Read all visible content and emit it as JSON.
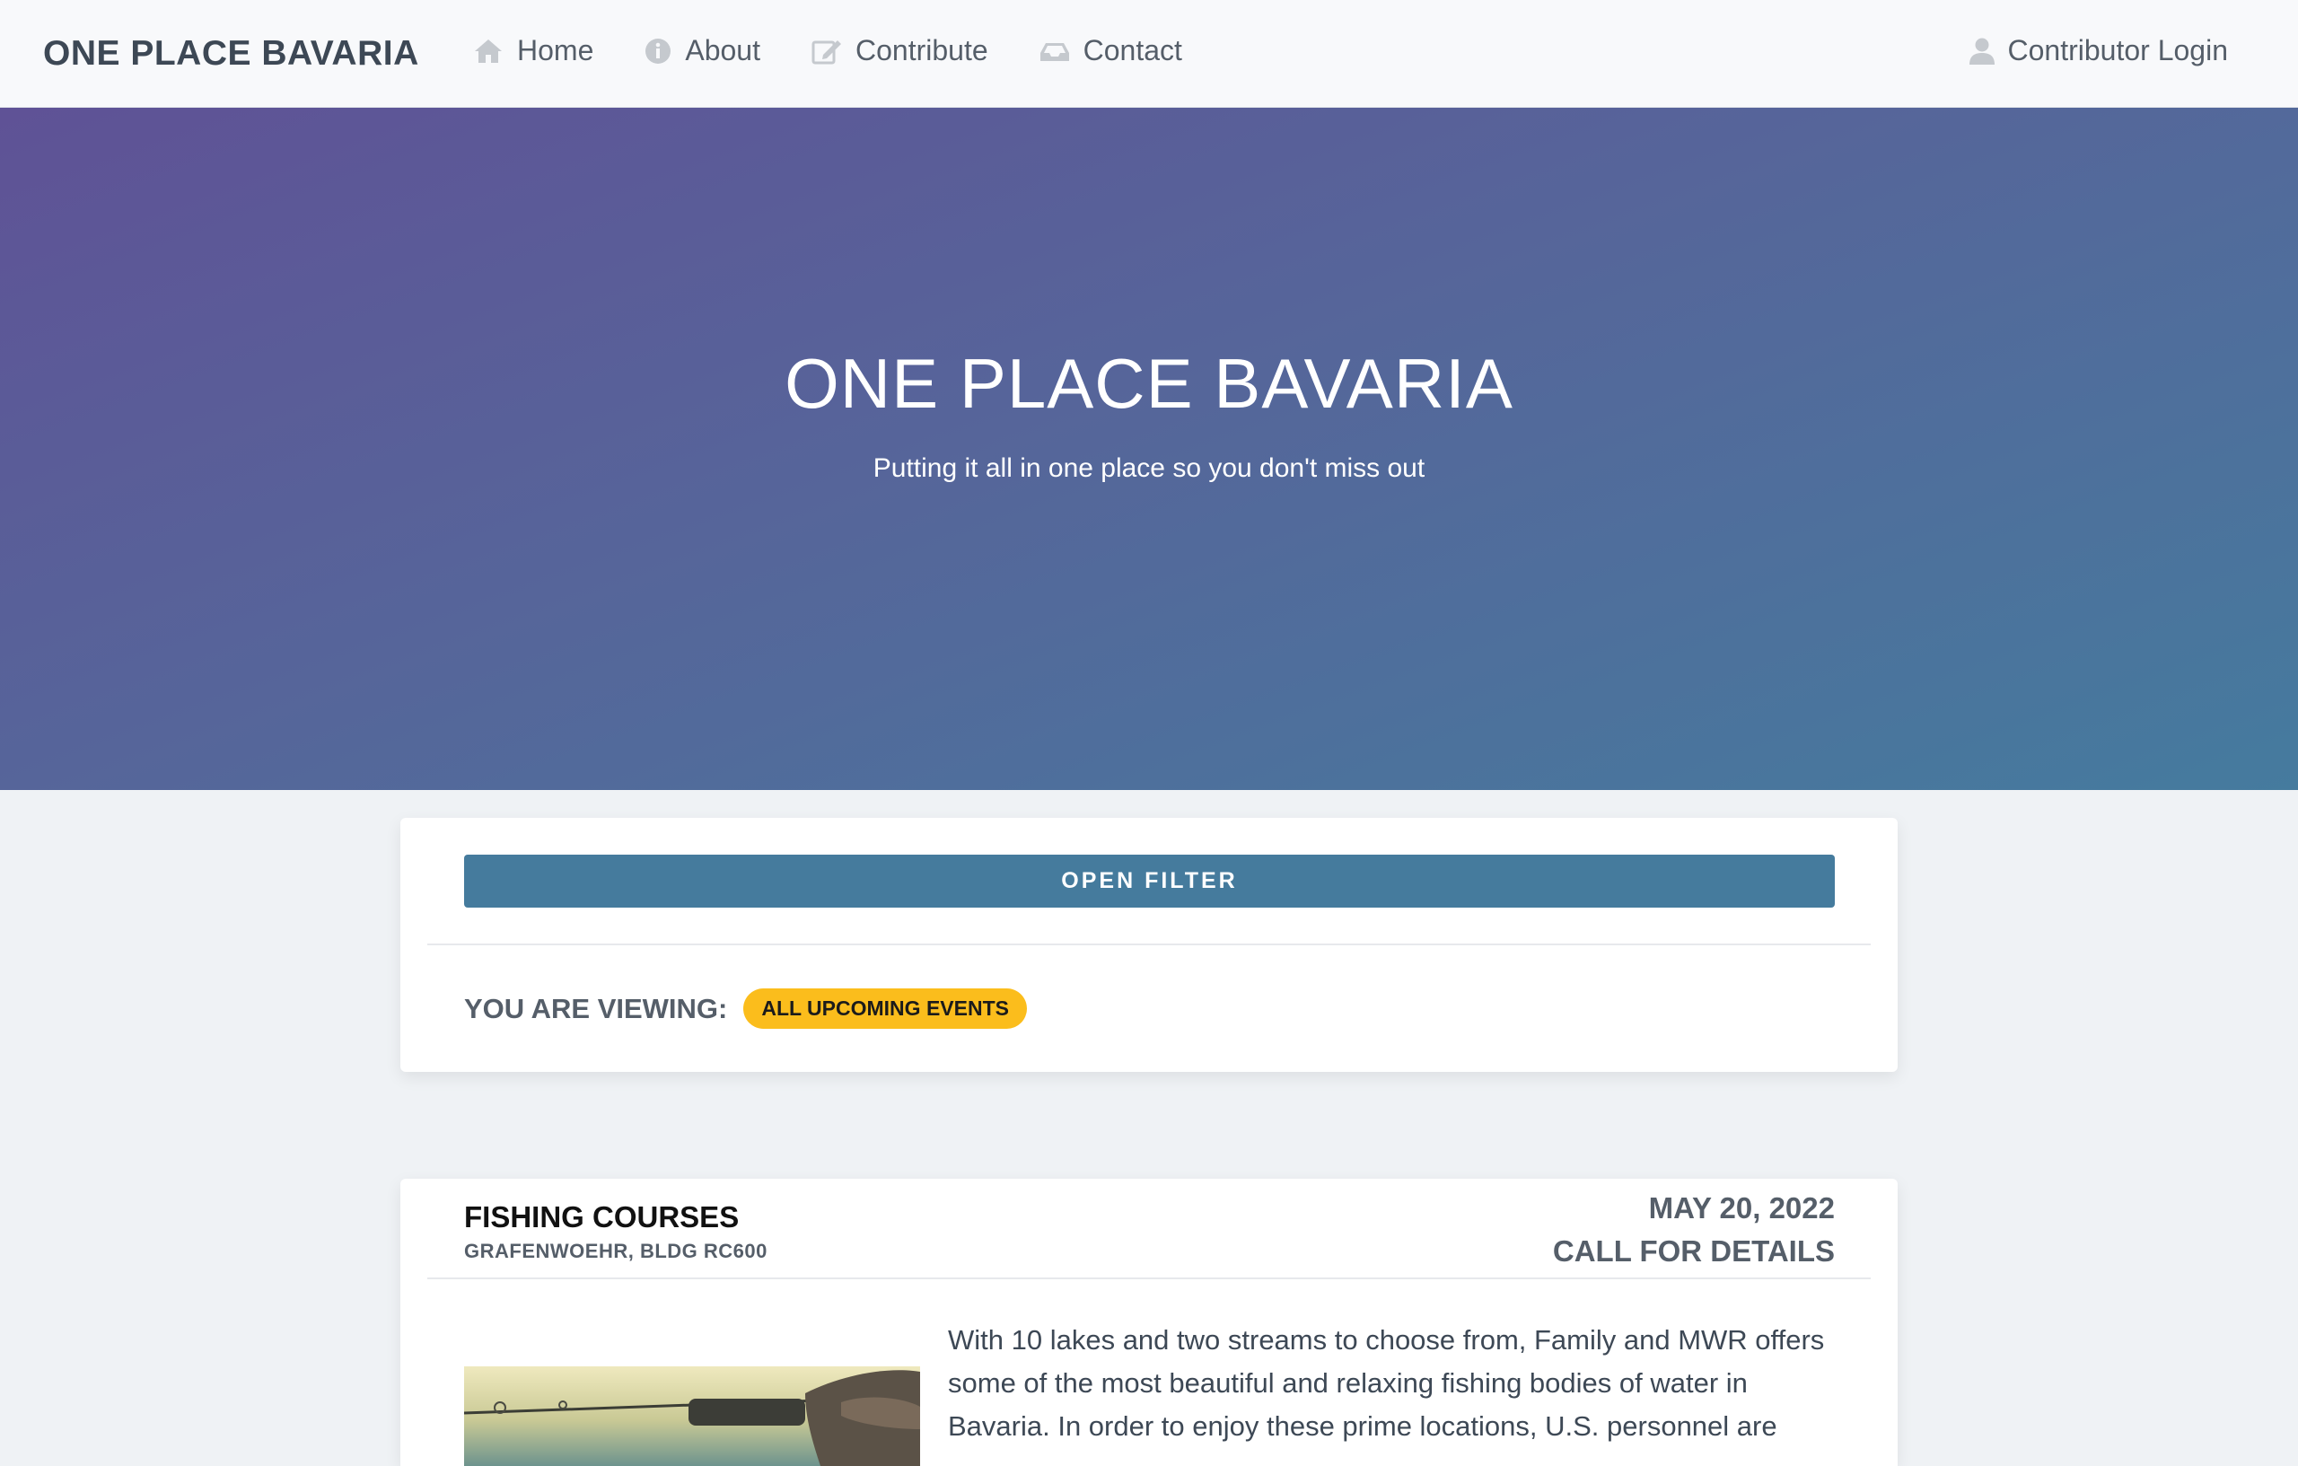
{
  "nav": {
    "brand": "ONE PLACE BAVARIA",
    "links": [
      {
        "label": "Home",
        "icon": "home-icon"
      },
      {
        "label": "About",
        "icon": "info-icon"
      },
      {
        "label": "Contribute",
        "icon": "edit-icon"
      },
      {
        "label": "Contact",
        "icon": "inbox-icon"
      }
    ],
    "login": {
      "label": "Contributor Login",
      "icon": "user-icon"
    }
  },
  "hero": {
    "title": "ONE PLACE BAVARIA",
    "subtitle": "Putting it all in one place so you don't miss out"
  },
  "filter": {
    "button_label": "OPEN FILTER",
    "viewing_label": "YOU ARE VIEWING:",
    "viewing_badge": "ALL UPCOMING EVENTS"
  },
  "events": [
    {
      "title": "FISHING COURSES",
      "location": "GRAFENWOEHR, BLDG RC600",
      "date": "MAY 20, 2022",
      "time": "CALL FOR DETAILS",
      "description": "With 10 lakes and two streams to choose from, Family and MWR offers some of the most beautiful and relaxing fishing bodies of water in Bavaria. In order to enjoy these prime locations, U.S. personnel are"
    }
  ],
  "colors": {
    "nav_bg": "#f8f9fb",
    "hero_start": "#5f5296",
    "hero_end": "#457b9e",
    "button": "#457b9d",
    "badge": "#fbbd1c",
    "page_bg": "#eff2f5"
  }
}
